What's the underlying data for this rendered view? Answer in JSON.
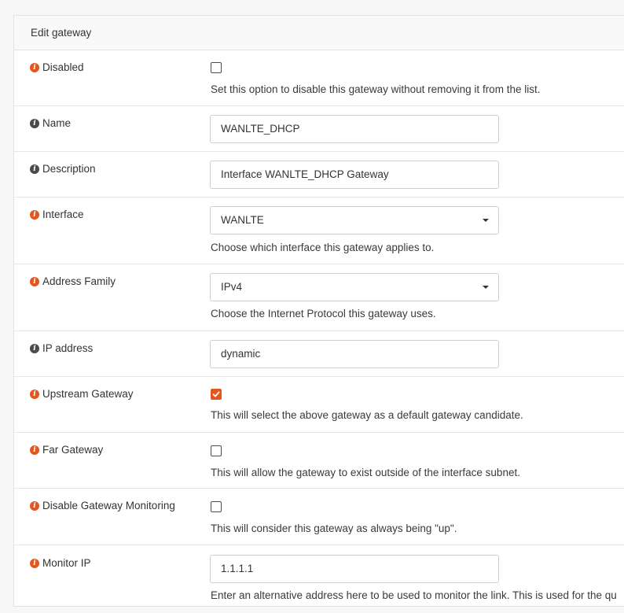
{
  "panel": {
    "title": "Edit gateway",
    "rows": [
      {
        "label": "Disabled",
        "icon": "orange",
        "checked": false,
        "help": "Set this option to disable this gateway without removing it from the list."
      },
      {
        "label": "Name",
        "icon": "gray",
        "value": "WANLTE_DHCP"
      },
      {
        "label": "Description",
        "icon": "gray",
        "value": "Interface WANLTE_DHCP Gateway"
      },
      {
        "label": "Interface",
        "icon": "orange",
        "selected": "WANLTE",
        "help": "Choose which interface this gateway applies to."
      },
      {
        "label": "Address Family",
        "icon": "orange",
        "selected": "IPv4",
        "help": "Choose the Internet Protocol this gateway uses."
      },
      {
        "label": "IP address",
        "icon": "gray",
        "value": "dynamic"
      },
      {
        "label": "Upstream Gateway",
        "icon": "orange",
        "checked": true,
        "help": "This will select the above gateway as a default gateway candidate."
      },
      {
        "label": "Far Gateway",
        "icon": "orange",
        "checked": false,
        "help": "This will allow the gateway to exist outside of the interface subnet."
      },
      {
        "label": "Disable Gateway Monitoring",
        "icon": "orange",
        "checked": false,
        "help": "This will consider this gateway as always being \"up\"."
      },
      {
        "label": "Monitor IP",
        "icon": "orange",
        "value": "1.1.1.1",
        "help": "Enter an alternative address here to be used to monitor the link. This is used for the qu"
      }
    ]
  },
  "icons": {
    "info": "info-circle-icon",
    "checkmark": "checkmark-icon",
    "dropdown": "caret-down-icon"
  },
  "colors": {
    "accent": "#e5561f",
    "info_gray": "#4a4a4a"
  }
}
